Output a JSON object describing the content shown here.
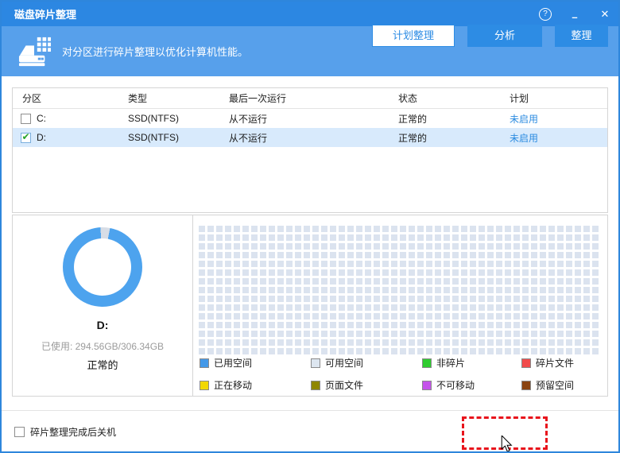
{
  "window": {
    "title": "磁盘碎片整理",
    "controls": {
      "help": "?",
      "minimize": "–",
      "close": "✕"
    }
  },
  "banner": {
    "text": "对分区进行碎片整理以优化计算机性能。"
  },
  "table": {
    "columns": [
      "分区",
      "类型",
      "最后一次运行",
      "状态",
      "计划"
    ],
    "rows": [
      {
        "partition": "C:",
        "type": "SSD(NTFS)",
        "last_run": "从不运行",
        "status": "正常的",
        "schedule": "未启用",
        "checked": false,
        "selected": false
      },
      {
        "partition": "D:",
        "type": "SSD(NTFS)",
        "last_run": "从不运行",
        "status": "正常的",
        "schedule": "未启用",
        "checked": true,
        "selected": true
      }
    ]
  },
  "usage": {
    "drive_label": "D:",
    "used_text": "已使用: 294.56GB/306.34GB",
    "status_text": "正常的",
    "used_percent": 96.15,
    "ring_color": "#4da3ee",
    "free_color": "#d7dde6"
  },
  "block_map": {
    "columns": 46,
    "rows": 15,
    "cell_color": "#dbe3ef"
  },
  "legend": {
    "items": [
      {
        "label": "已用空间",
        "color": "#4398e8"
      },
      {
        "label": "可用空间",
        "color": "#dde6f0"
      },
      {
        "label": "非碎片",
        "color": "#2fcc2f"
      },
      {
        "label": "碎片文件",
        "color": "#f14b4b"
      },
      {
        "label": "正在移动",
        "color": "#f2d800"
      },
      {
        "label": "页面文件",
        "color": "#8f8600"
      },
      {
        "label": "不可移动",
        "color": "#c553ea"
      },
      {
        "label": "预留空间",
        "color": "#8a4412"
      }
    ]
  },
  "footer": {
    "shutdown_label": "碎片整理完成后关机",
    "schedule_button": "计划整理",
    "analyze_button": "分析",
    "defrag_button": "整理"
  },
  "colors": {
    "titlebar": "#2c87e2",
    "banner": "#57a0eb",
    "accent": "#2d8ce4",
    "row_highlight": "#d8eafc",
    "annotation_red": "#e8141c"
  }
}
